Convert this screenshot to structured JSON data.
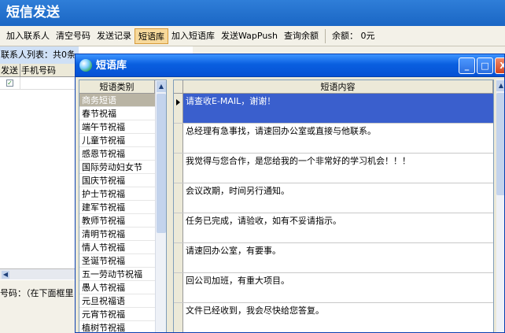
{
  "app": {
    "title": "短信发送"
  },
  "toolbar": {
    "items": [
      {
        "label": "加入联系人"
      },
      {
        "label": "清空号码"
      },
      {
        "label": "发送记录"
      },
      {
        "label": "短语库",
        "active": true
      },
      {
        "label": "加入短语库"
      },
      {
        "label": "发送WapPush"
      },
      {
        "label": "查询余额"
      },
      {
        "label": "余额： 0元"
      }
    ]
  },
  "contacts": {
    "header": "联系人列表：共0条",
    "columns": [
      "发送",
      "手机号码"
    ]
  },
  "bottom": {
    "phone_label": "号码：（在下面框里"
  },
  "dialog": {
    "title": "短语库",
    "buttons": {
      "min": "_",
      "max": "□",
      "close": "X"
    }
  },
  "categories": {
    "header": "短语类别",
    "items": [
      "商务短语",
      "春节祝福",
      "端午节祝福",
      "儿童节祝福",
      "感恩节祝福",
      "国际劳动妇女节",
      "国庆节祝福",
      "护士节祝福",
      "建军节祝福",
      "教师节祝福",
      "清明节祝福",
      "情人节祝福",
      "圣诞节祝福",
      "五一劳动节祝福",
      "愚人节祝福",
      "元旦祝福语",
      "元宵节祝福",
      "植树节祝福"
    ],
    "selected_index": 0
  },
  "phrases": {
    "header": "短语内容",
    "items": [
      "请查收E-MAIL，谢谢！",
      "总经理有急事找，请速回办公室或直接与他联系。",
      "我觉得与您合作，是您给我的一个非常好的学习机会！！！",
      "会议改期，时间另行通知。",
      "任务已完成，请验收，如有不妥请指示。",
      "请速回办公室，有要事。",
      "回公司加班，有重大项目。",
      "文件已经收到，我会尽快给您答复。"
    ],
    "selected_index": 0
  },
  "colors": {
    "title_bar": "#0a5fe0",
    "selection": "#3a5fcd",
    "active_tab": "#f7d99b"
  }
}
